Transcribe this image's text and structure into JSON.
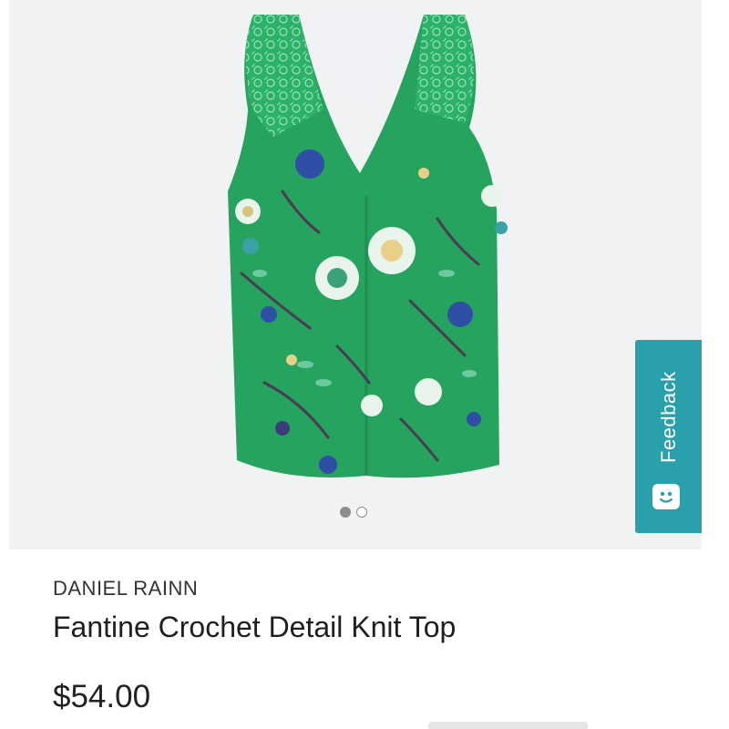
{
  "product": {
    "brand": "DANIEL RAINN",
    "title": "Fantine Crochet Detail Knit Top",
    "price": "$54.00",
    "image_description": "Green floral sleeveless knit top with crochet lace shoulders"
  },
  "carousel": {
    "total": 2,
    "active_index": 1
  },
  "feedback": {
    "label": "Feedback",
    "icon": "smiley-face-icon",
    "color": "#2aa0ac"
  },
  "colors": {
    "garment_green": "#26a35f",
    "background": "#f1f2f4"
  }
}
